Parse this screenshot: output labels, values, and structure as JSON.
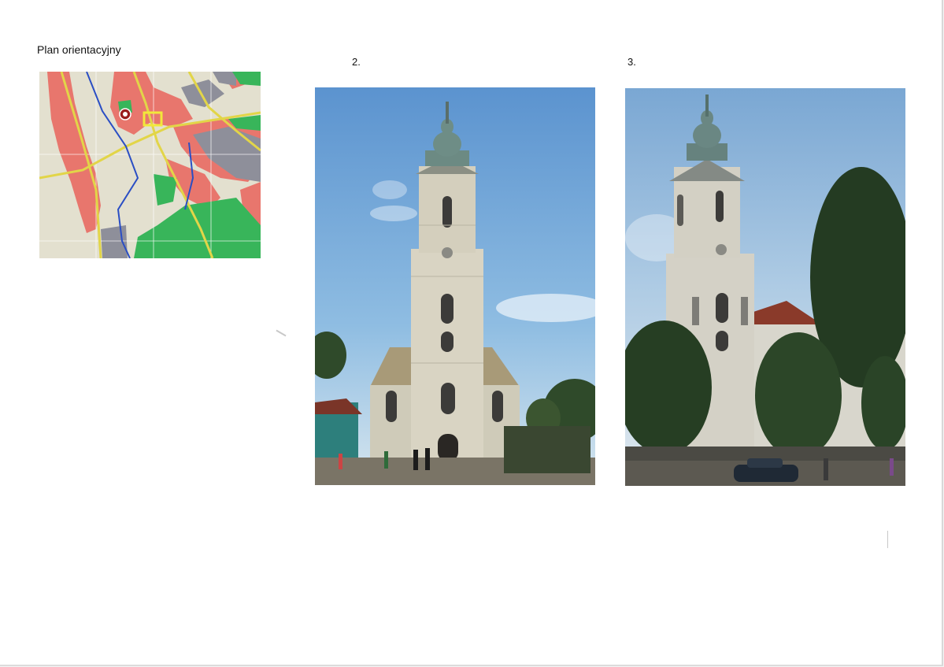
{
  "map": {
    "title": "Plan orientacyjny",
    "colors": {
      "built": "#e8766d",
      "parks": "#38b55a",
      "industry": "#8e8f9a",
      "roads": "#e2d548",
      "water": "#2a4ec4",
      "ground": "#e3e0cf"
    }
  },
  "photos": [
    {
      "label": "2.",
      "subject": "church-tower-front"
    },
    {
      "label": "3.",
      "subject": "church-tower-side"
    }
  ]
}
